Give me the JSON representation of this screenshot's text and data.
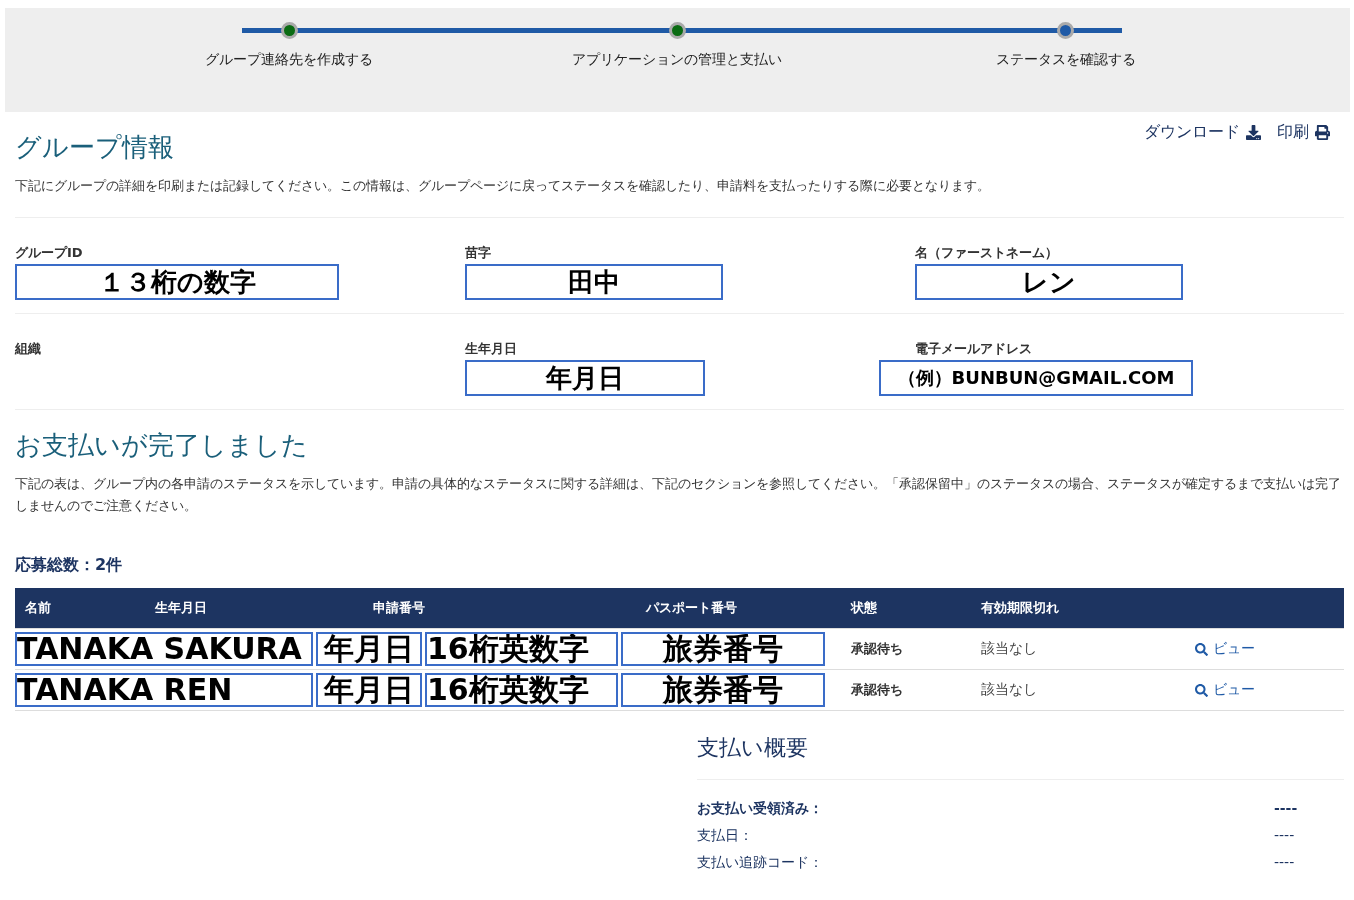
{
  "steps": [
    {
      "label": "グループ連絡先を作成する",
      "completed": true
    },
    {
      "label": "アプリケーションの管理と支払い",
      "completed": true
    },
    {
      "label": "ステータスを確認する",
      "completed": false
    }
  ],
  "group_info": {
    "title": "グループ情報",
    "actions": [
      {
        "label": "ダウンロード",
        "kind": "download"
      },
      {
        "label": "印刷",
        "kind": "print"
      }
    ],
    "description": "下記にグループの詳細を印刷または記録してください。この情報は、グループページに戻ってステータスを確認したり、申請料を支払ったりする際に必要となります。",
    "fields": [
      {
        "label": "グループID",
        "value": "１３桁の数字"
      },
      {
        "label": "苗字",
        "value": "田中"
      },
      {
        "label": "名（ファーストネーム）",
        "value": "レン"
      },
      {
        "label": "組織"
      },
      {
        "label": "生年月日",
        "value": "年月日"
      },
      {
        "label": "電子メールアドレス",
        "value": "（例）BUNBUN@GMAIL.COM"
      }
    ]
  },
  "payment": {
    "title": "お支払いが完了しました",
    "description": "下記の表は、グループ内の各申請のステータスを示しています。申請の具体的なステータスに関する詳細は、下記のセクションを参照してください。「承認保留中」のステータスの場合、ステータスが確定するまで支払いは完了しませんのでご注意ください。",
    "total": "応募総数：2件"
  },
  "table": {
    "columns": [
      "名前",
      "生年月日",
      "申請番号",
      "パスポート番号",
      "状態",
      "有効期限切れ"
    ],
    "rows": [
      {
        "name": "TANAKA SAKURA",
        "dob": "年月日",
        "app": "16桁英数字",
        "passport": "旅券番号",
        "status": "承認待ち",
        "expiry": "該当なし",
        "link": "ビュー"
      },
      {
        "name": "TANAKA REN",
        "dob": "年月日",
        "app": "16桁英数字",
        "passport": "旅券番号",
        "status": "承認待ち",
        "expiry": "該当なし",
        "link": "ビュー"
      }
    ]
  },
  "summary": {
    "title": "支払い概要",
    "items": [
      {
        "label": "お支払い受領済み：",
        "value": "----",
        "strong": true
      },
      {
        "label": "支払日：",
        "value": "----",
        "strong": false
      },
      {
        "label": "支払い追跡コード：",
        "value": "----",
        "strong": false
      }
    ]
  }
}
